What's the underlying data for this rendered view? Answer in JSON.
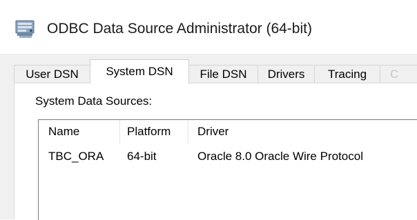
{
  "window": {
    "title": "ODBC Data Source Administrator (64-bit)",
    "icon": "odbc-admin-icon"
  },
  "tabs": [
    {
      "label": "User DSN",
      "active": false
    },
    {
      "label": "System DSN",
      "active": true
    },
    {
      "label": "File DSN",
      "active": false
    },
    {
      "label": "Drivers",
      "active": false
    },
    {
      "label": "Tracing",
      "active": false
    },
    {
      "label": "C",
      "active": false
    }
  ],
  "system_dsn": {
    "section_label": "System Data Sources:",
    "columns": [
      "Name",
      "Platform",
      "Driver"
    ],
    "rows": [
      {
        "name": "TBC_ORA",
        "platform": "64-bit",
        "driver": "Oracle 8.0 Oracle Wire Protocol"
      }
    ]
  },
  "colors": {
    "window_bg": "#ffffff",
    "client_bg": "#f0f0f0",
    "tab_border": "#d5d5d5",
    "list_border": "#7a7a7a"
  }
}
